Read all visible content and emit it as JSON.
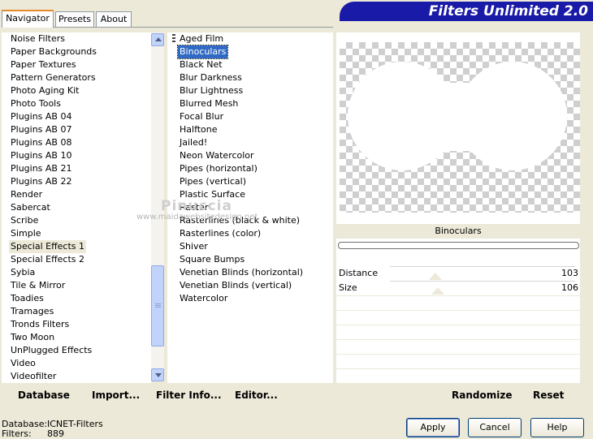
{
  "tabs": [
    "Navigator",
    "Presets",
    "About"
  ],
  "banner_title": "Filters Unlimited 2.0",
  "categories": [
    "Noise Filters",
    "Paper Backgrounds",
    "Paper Textures",
    "Pattern Generators",
    "Photo Aging Kit",
    "Photo Tools",
    "Plugins AB 04",
    "Plugins AB 07",
    "Plugins AB 08",
    "Plugins AB 10",
    "Plugins AB 21",
    "Plugins AB 22",
    "Render",
    "Sabercat",
    "Scribe",
    "Simple",
    "Special Effects 1",
    "Special Effects 2",
    "Sybia",
    "Tile & Mirror",
    "Toadies",
    "Tramages",
    "Tronds Filters",
    "Two Moon",
    "UnPlugged Effects",
    "Video",
    "Videofilter"
  ],
  "selected_category": "Special Effects 1",
  "filters": [
    "Aged Film",
    "Binoculars",
    "Black Net",
    "Blur Darkness",
    "Blur Lightness",
    "Blurred Mesh",
    "Focal Blur",
    "Halftone",
    "Jailed!",
    "Neon Watercolor",
    "Pipes (horizontal)",
    "Pipes (vertical)",
    "Plastic Surface",
    "Raster",
    "Rasterlines (black & white)",
    "Rasterlines (color)",
    "Shiver",
    "Square Bumps",
    "Venetian Blinds (horizontal)",
    "Venetian Blinds (vertical)",
    "Watercolor"
  ],
  "selected_filter": "Binoculars",
  "preview_filter_name": "Binoculars",
  "params": [
    {
      "label": "Distance",
      "value": "103"
    },
    {
      "label": "Size",
      "value": "106"
    }
  ],
  "bottom_buttons": {
    "database": "Database",
    "import": "Import...",
    "filter_info": "Filter Info...",
    "editor": "Editor...",
    "randomize": "Randomize",
    "reset": "Reset"
  },
  "status": {
    "database_label": "Database:",
    "database_value": "ICNET-Filters",
    "filters_label": "Filters:",
    "filters_value": "889"
  },
  "dialog_buttons": {
    "apply": "Apply",
    "cancel": "Cancel",
    "help": "Help"
  },
  "watermark": {
    "line1": "Pinuccia",
    "line2": "www.maidawebsitedesign.net"
  }
}
